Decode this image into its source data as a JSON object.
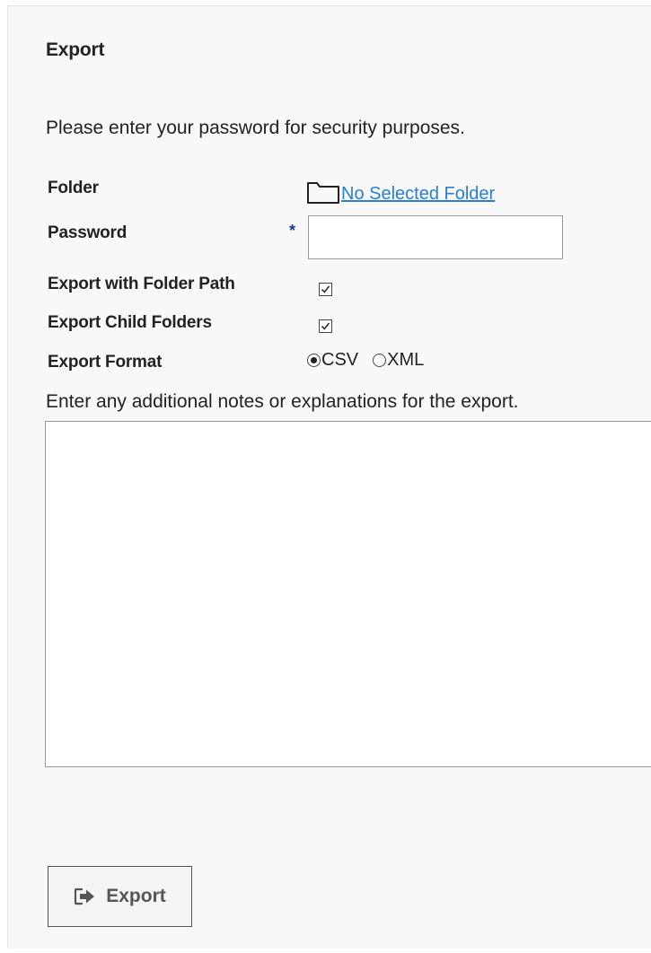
{
  "dialog": {
    "title": "Export",
    "intro": "Please enter your password for security purposes."
  },
  "form": {
    "folder": {
      "label": "Folder",
      "link_text": "No Selected Folder",
      "icon": "folder-icon"
    },
    "password": {
      "label": "Password",
      "required_marker": "*",
      "value": ""
    },
    "export_with_folder_path": {
      "label": "Export with Folder Path",
      "checked": true
    },
    "export_child_folders": {
      "label": "Export Child Folders",
      "checked": true
    },
    "export_format": {
      "label": "Export Format",
      "options": [
        "CSV",
        "XML"
      ],
      "selected": "CSV"
    },
    "notes": {
      "instruction": "Enter any additional notes or explanations for the export.",
      "value": ""
    }
  },
  "actions": {
    "export_label": "Export",
    "export_icon": "sign-out-arrow-icon"
  },
  "colors": {
    "link": "#2a7ed6",
    "required_marker": "#1b3a8a",
    "panel_background": "#f8f8f8",
    "button_text": "#555555"
  }
}
